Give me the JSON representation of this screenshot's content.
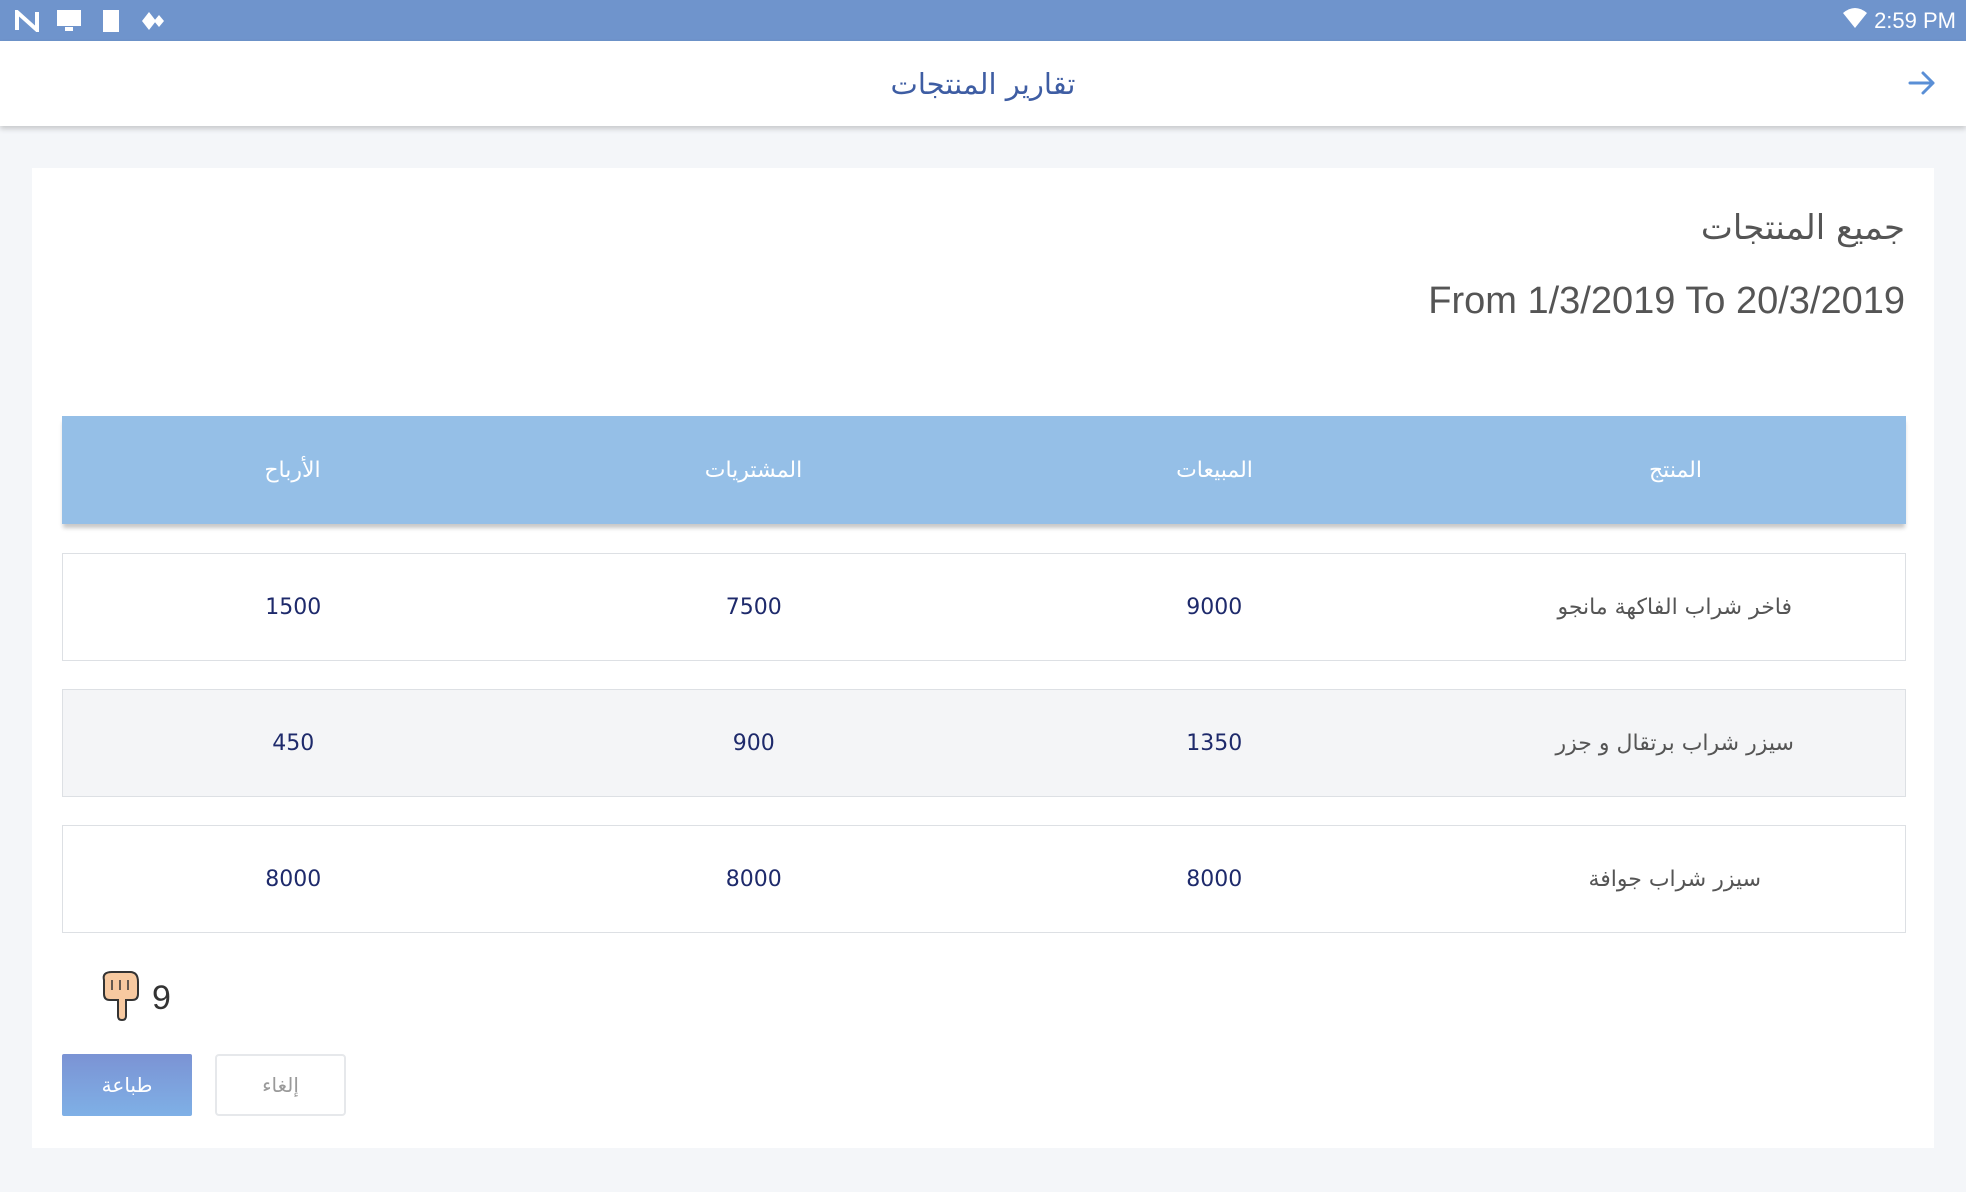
{
  "status_bar": {
    "icons": [
      "n-icon",
      "monitor-icon",
      "sd-card-icon",
      "diamond-icon",
      "wifi-icon"
    ],
    "time": "2:59 PM",
    "color": "#6f94cc"
  },
  "app_bar": {
    "title": "تقارير المنتجات",
    "back_icon": "arrow-right-icon"
  },
  "report": {
    "title": "جميع المنتجات",
    "range": "From 1/3/2019 To 20/3/2019"
  },
  "table": {
    "headers": [
      "المنتج",
      "المبيعات",
      "المشتريات",
      "الأرباح"
    ],
    "rows": [
      {
        "product": "فاخر شراب الفاكهة مانجو",
        "sales": "9000",
        "purchases": "7500",
        "profits": "1500"
      },
      {
        "product": "سيزر شراب برتقال و جزر",
        "sales": "1350",
        "purchases": "900",
        "profits": "450"
      },
      {
        "product": "سيزر شراب جوافة",
        "sales": "8000",
        "purchases": "8000",
        "profits": "8000"
      }
    ],
    "header_color": "#95bfe7"
  },
  "hint": {
    "icon": "pointing-hand-icon",
    "count": "9"
  },
  "actions": {
    "print_label": "طباعة",
    "cancel_label": "إلغاء"
  }
}
